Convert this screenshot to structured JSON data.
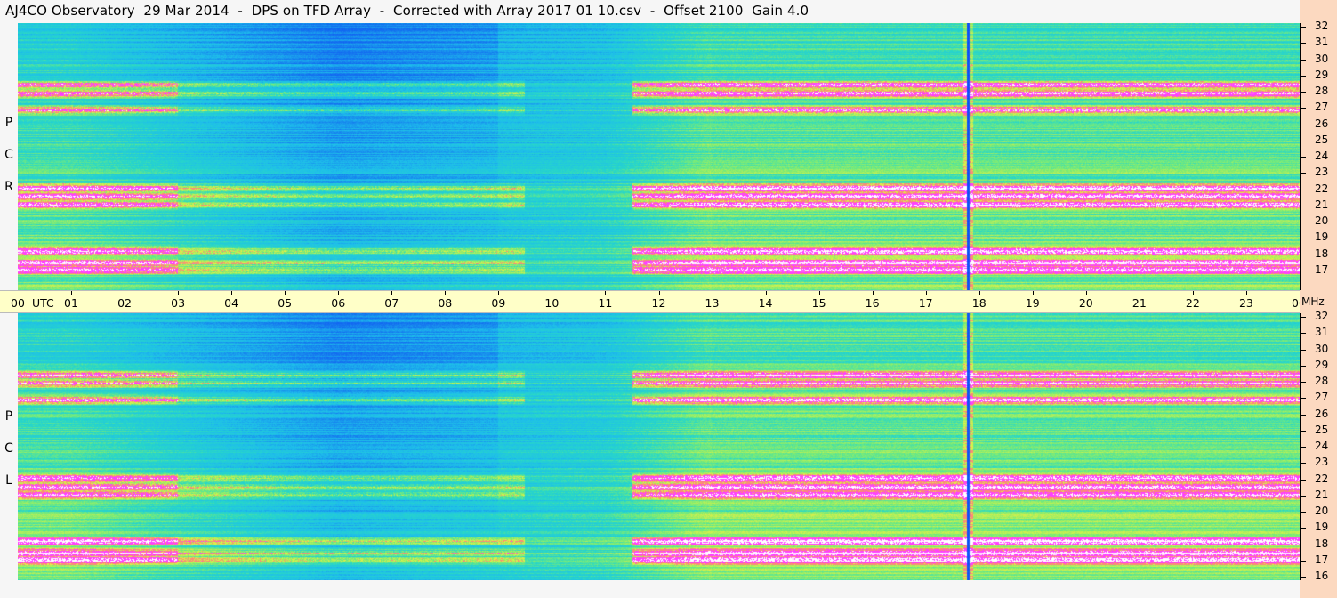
{
  "title": "AJ4CO Observatory  29 Mar 2014  -  DPS on TFD Array  -  Corrected with Array 2017 01 10.csv  -  Offset 2100  Gain 4.0",
  "panels": {
    "rcp": {
      "label_letters": [
        "P",
        "C",
        "R"
      ]
    },
    "lcp": {
      "label_letters": [
        "P",
        "C",
        "L"
      ]
    }
  },
  "time_axis": {
    "start_label": "00",
    "utc_label": "UTC",
    "ticks": [
      "01",
      "02",
      "03",
      "04",
      "05",
      "06",
      "07",
      "08",
      "09",
      "10",
      "11",
      "12",
      "13",
      "14",
      "15",
      "16",
      "17",
      "18",
      "19",
      "20",
      "21",
      "22",
      "23"
    ],
    "end_label": "00",
    "unit_label": "MHz"
  },
  "freq_axis": {
    "ticks": [
      "32",
      "31",
      "30",
      "29",
      "28",
      "27",
      "26",
      "25",
      "24",
      "23",
      "22",
      "21",
      "20",
      "19",
      "18",
      "17",
      "16"
    ]
  },
  "chart_data": {
    "type": "heatmap",
    "title": "AJ4CO Observatory  29 Mar 2014  -  DPS on TFD Array  -  Corrected with Array 2017 01 10.csv  -  Offset 2100  Gain 4.0",
    "x_range_utc_hours": [
      0,
      24
    ],
    "y_range_mhz": [
      16,
      32
    ],
    "series": [
      {
        "name": "RCP"
      },
      {
        "name": "LCP"
      }
    ],
    "colors": {
      "low": "#0a3cff",
      "mid": "#20c8e8",
      "high": "#c8f050",
      "saturated": "#ff40ff",
      "clip": "#ffffff",
      "strip_bg": "#ffffc8",
      "freq_strip_bg": "#fcd9c0"
    },
    "interference_bands_mhz": [
      17.2,
      17.6,
      18.3,
      21.1,
      21.6,
      22.1,
      26.8,
      27.8,
      28.3
    ],
    "noise_burst_utc": 17.8
  }
}
